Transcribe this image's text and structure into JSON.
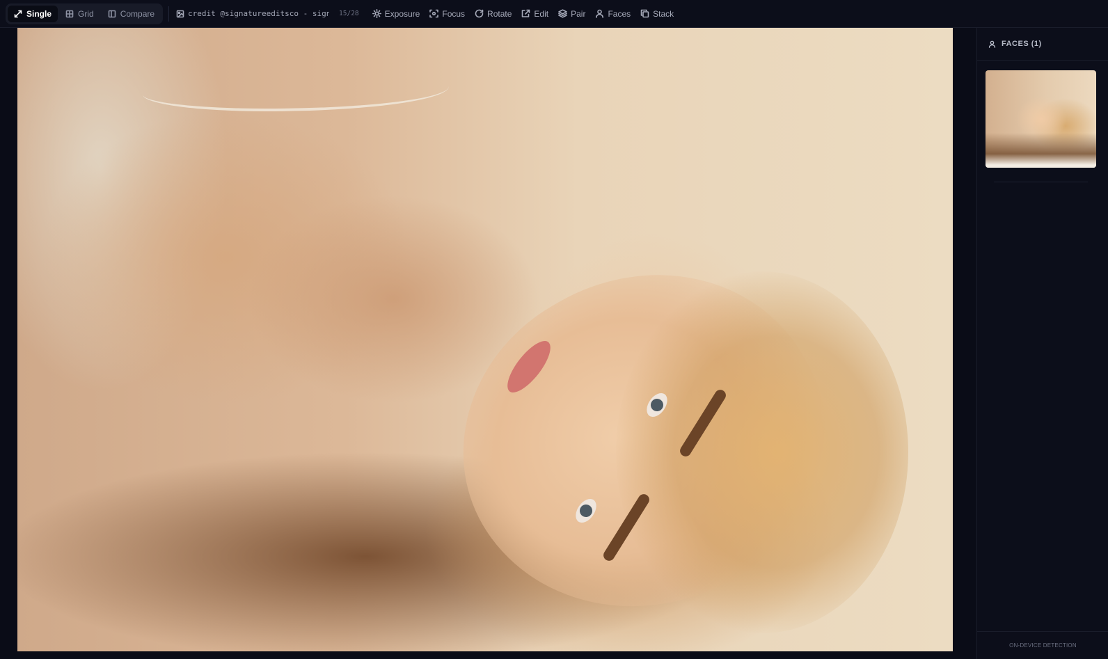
{
  "toolbar": {
    "view_modes": [
      {
        "label": "Single",
        "icon": "expand-icon",
        "active": true
      },
      {
        "label": "Grid",
        "icon": "grid-icon",
        "active": false
      },
      {
        "label": "Compare",
        "icon": "columns-icon",
        "active": false
      }
    ],
    "filename": "credit @signatureeditsco - signa…",
    "counter": "15/28",
    "tools": [
      {
        "label": "Exposure",
        "icon": "sun-icon"
      },
      {
        "label": "Focus",
        "icon": "focus-icon"
      },
      {
        "label": "Rotate",
        "icon": "rotate-icon"
      },
      {
        "label": "Edit",
        "icon": "external-edit-icon"
      },
      {
        "label": "Pair",
        "icon": "layers-icon"
      },
      {
        "label": "Faces",
        "icon": "user-icon"
      },
      {
        "label": "Stack",
        "icon": "copy-icon"
      }
    ]
  },
  "sidebar": {
    "title": "FACES (1)",
    "footer": "ON-DEVICE DETECTION"
  },
  "colors": {
    "background": "#0b0d17",
    "panel": "#0c0e1a",
    "active_segment": "#0a0c15"
  }
}
